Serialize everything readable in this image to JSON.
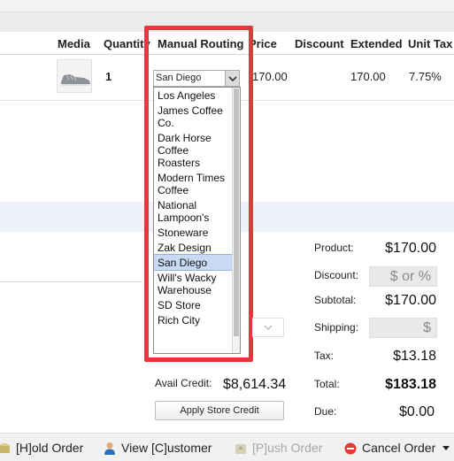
{
  "table": {
    "headers": {
      "media": "Media",
      "quantity": "Quantity",
      "manual_routing": "Manual Routing",
      "price": "Price",
      "discount": "Discount",
      "extended": "Extended",
      "unit_tax": "Unit Tax"
    },
    "row": {
      "quantity": "1",
      "price": "170.00",
      "extended": "170.00",
      "unit_tax": "7.75%",
      "routing_selected": "San Diego"
    }
  },
  "routing_dropdown": {
    "options": [
      "Los Angeles",
      "James Coffee\nCo.",
      "Dark Horse\nCoffee\nRoasters",
      "Modern Times\nCoffee",
      "National\nLampoon's",
      "Stoneware",
      "Zak Design",
      "San Diego",
      "Will's Wacky\nWarehouse",
      "SD Store",
      "Rich City"
    ],
    "selected_index": 7
  },
  "summary": {
    "product_label": "Product:",
    "product_value": "$170.00",
    "discount_label": "Discount:",
    "discount_placeholder": "$ or %",
    "subtotal_label": "Subtotal:",
    "subtotal_value": "$170.00",
    "shipping_label": "Shipping:",
    "shipping_placeholder": "$",
    "tax_label": "Tax:",
    "tax_value": "$13.18",
    "total_label": "Total:",
    "total_value": "$183.18",
    "due_label": "Due:",
    "due_value": "$0.00"
  },
  "credit": {
    "avail_label": "Avail Credit:",
    "avail_value": "$8,614.34",
    "apply_button": "Apply Store Credit"
  },
  "actions": {
    "hold": "[H]old Order",
    "customer": "View [C]ustomer",
    "push": "[P]ush Order",
    "cancel": "Cancel Order"
  },
  "colors": {
    "highlight": "#e8363f",
    "selected_option": "#c8daf4",
    "cancel_icon": "#e53935",
    "customer_icon": "#2f6fb8"
  }
}
